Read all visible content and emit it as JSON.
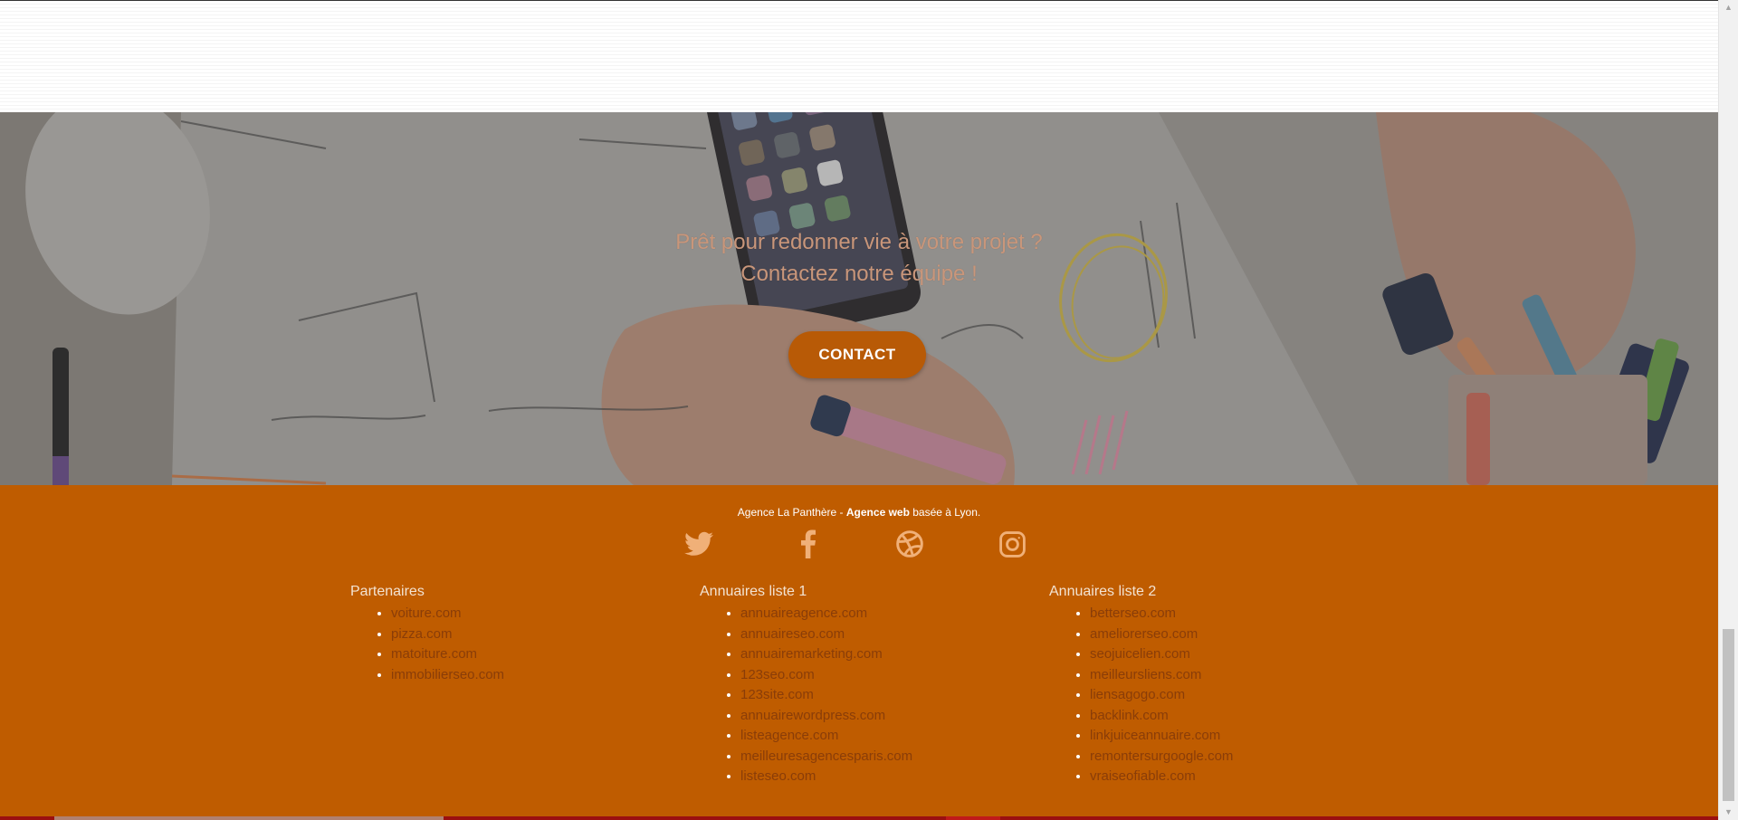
{
  "hero": {
    "line1": "Prêt pour redonner vie à votre projet ?",
    "line2": "Contactez notre équipe !",
    "contact_label": "CONTACT"
  },
  "footer": {
    "tagline_part1": "Agence La Panthère - ",
    "tagline_bold": "Agence web",
    "tagline_part2": " basée à Lyon.",
    "social": [
      "twitter-icon",
      "facebook-icon",
      "dribbble-icon",
      "instagram-icon"
    ],
    "columns": [
      {
        "title": "Partenaires",
        "links": [
          "voiture.com",
          "pizza.com",
          "matoiture.com",
          "immobilierseo.com"
        ]
      },
      {
        "title": "Annuaires liste 1",
        "links": [
          "annuaireagence.com",
          "annuaireseo.com",
          "annuairemarketing.com",
          "123seo.com",
          "123site.com",
          "annuairewordpress.com",
          "listeagence.com",
          "meilleuresagencesparis.com",
          "listeseo.com"
        ]
      },
      {
        "title": "Annuaires liste 2",
        "links": [
          "betterseo.com",
          "ameliorerseo.com",
          "seojuicelien.com",
          "meilleursliens.com",
          "liensagogo.com",
          "backlink.com",
          "linkjuiceannuaire.com",
          "remontersurgoogle.com",
          "vraiseofiable.com"
        ]
      }
    ]
  },
  "colors": {
    "footer_bg": "#bf5c00",
    "button_bg": "#b85a06",
    "hero_text": "#c9967a",
    "link_text": "#8a3d08"
  }
}
